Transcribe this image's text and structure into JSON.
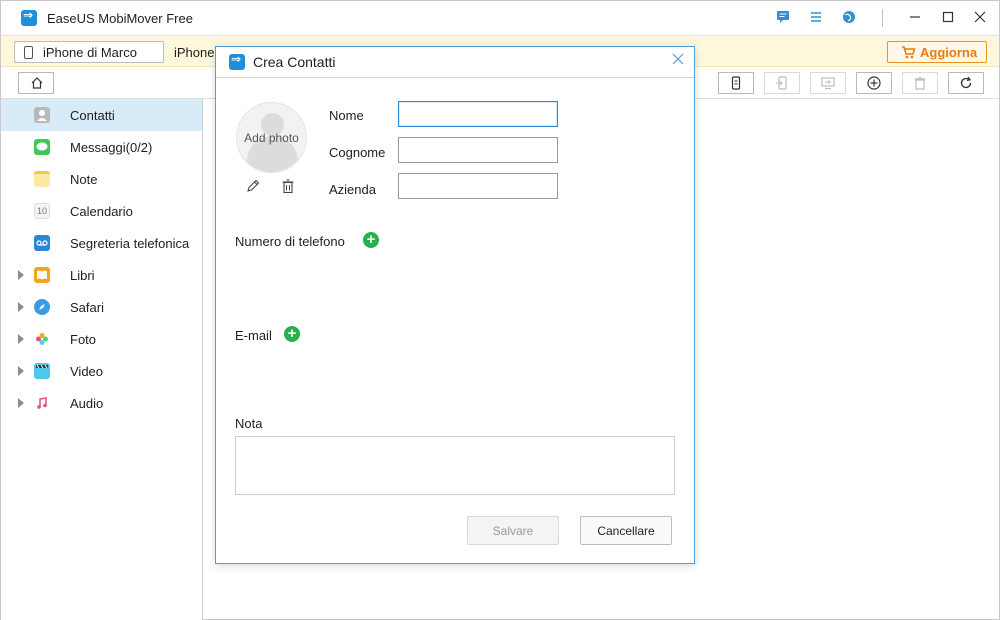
{
  "app": {
    "title": "EaseUS MobiMover Free"
  },
  "titlebar_icons": [
    "feedback-icon",
    "menu-icon",
    "globe-icon"
  ],
  "window_controls": [
    "minimize",
    "maximize",
    "close"
  ],
  "devicebar": {
    "device_name": "iPhone di Marco",
    "device_label_partial": "iPhone",
    "upgrade_label": "Aggiorna"
  },
  "toolbar": {
    "buttons": [
      "phone-transfer-icon",
      "import-icon",
      "export-to-pc-icon",
      "add-icon",
      "delete-icon",
      "refresh-icon"
    ]
  },
  "sidebar": {
    "items": [
      {
        "label": "Contatti",
        "icon": "contacts-icon",
        "expandable": false,
        "active": true
      },
      {
        "label": "Messaggi(0/2)",
        "icon": "messages-icon",
        "expandable": false
      },
      {
        "label": "Note",
        "icon": "notes-icon",
        "expandable": false
      },
      {
        "label": "Calendario",
        "icon": "calendar-icon",
        "expandable": false
      },
      {
        "label": "Segreteria telefonica",
        "icon": "voicemail-icon",
        "expandable": false
      },
      {
        "label": "Libri",
        "icon": "books-icon",
        "expandable": true
      },
      {
        "label": "Safari",
        "icon": "safari-icon",
        "expandable": true
      },
      {
        "label": "Foto",
        "icon": "photos-icon",
        "expandable": true
      },
      {
        "label": "Video",
        "icon": "video-icon",
        "expandable": true
      },
      {
        "label": "Audio",
        "icon": "music-icon",
        "expandable": true
      }
    ]
  },
  "dialog": {
    "title": "Crea Contatti",
    "photo_label": "Add photo",
    "fields": {
      "nome_label": "Nome",
      "nome_value": "",
      "cognome_label": "Cognome",
      "cognome_value": "",
      "azienda_label": "Azienda",
      "azienda_value": ""
    },
    "phone_section_label": "Numero di telefono",
    "email_section_label": "E-mail",
    "note_label": "Nota",
    "note_value": "",
    "save_label": "Salvare",
    "cancel_label": "Cancellare"
  },
  "colors": {
    "accent": "#1e8fd8",
    "active_row": "#d8ebf8",
    "device_bar": "#fdf7dc",
    "upgrade": "#e77d09",
    "add_green": "#27b04d"
  }
}
